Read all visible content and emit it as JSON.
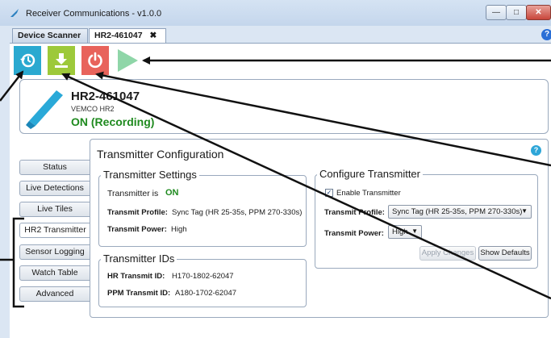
{
  "window": {
    "title": "Receiver Communications - v1.0.0"
  },
  "tabs": [
    {
      "label": "Device Scanner"
    },
    {
      "label": "HR2-461047"
    }
  ],
  "device": {
    "name": "HR2-461047",
    "model": "VEMCO HR2",
    "status": "ON (Recording)"
  },
  "side_tabs": [
    {
      "label": "Status"
    },
    {
      "label": "Live Detections"
    },
    {
      "label": "Live Tiles"
    },
    {
      "label": "HR2 Transmitter"
    },
    {
      "label": "Sensor Logging"
    },
    {
      "label": "Watch Table"
    },
    {
      "label": "Advanced"
    }
  ],
  "panel": {
    "title": "Transmitter Configuration",
    "settings": {
      "legend": "Transmitter Settings",
      "state_label": "Transmitter is",
      "state_value": "ON",
      "profile_label": "Transmit Profile:",
      "profile_value": "Sync Tag (HR 25-35s, PPM 270-330s)",
      "power_label": "Transmit Power:",
      "power_value": "High"
    },
    "ids": {
      "legend": "Transmitter IDs",
      "hr_label": "HR Transmit ID:",
      "hr_value": "H170-1802-62047",
      "ppm_label": "PPM Transmit ID:",
      "ppm_value": "A180-1702-62047"
    },
    "configure": {
      "legend": "Configure Transmitter",
      "enable_label": "Enable Transmitter",
      "enable_checked": true,
      "profile_label": "Transmit Profile:",
      "profile_selected": "Sync Tag (HR 25-35s, PPM 270-330s)",
      "power_label": "Transmit Power:",
      "power_selected": "High",
      "apply_label": "Apply Changes",
      "defaults_label": "Show Defaults"
    }
  },
  "icons": {
    "sync": "sync-clock-icon",
    "download": "download-icon",
    "power": "power-icon",
    "play": "play-icon"
  },
  "colors": {
    "sync": "#2aa9d0",
    "download": "#9dc93a",
    "power": "#e8635b",
    "play": "#8fd6a8",
    "status_on": "#1f8a1f"
  }
}
